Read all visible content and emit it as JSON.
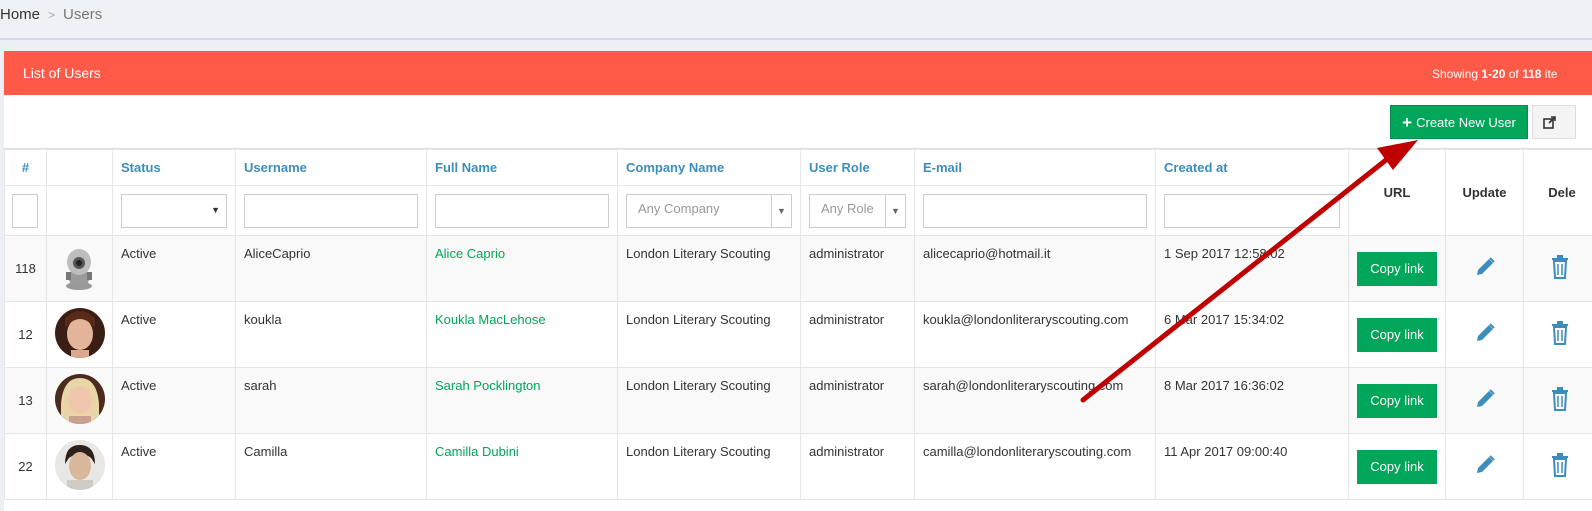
{
  "breadcrumb": {
    "home": "Home",
    "separator": ">",
    "current": "Users"
  },
  "panel": {
    "title": "List of Users",
    "summary_prefix": "Showing ",
    "summary_range": "1-20",
    "summary_of": " of ",
    "summary_total": "118",
    "summary_suffix": " ite"
  },
  "toolbar": {
    "create_label": "Create New User",
    "create_icon": "plus-icon",
    "export_icon": "export-icon"
  },
  "columns": {
    "num": "#",
    "status": "Status",
    "username": "Username",
    "fullname": "Full Name",
    "company": "Company Name",
    "role": "User Role",
    "email": "E-mail",
    "created": "Created at",
    "url": "URL",
    "update": "Update",
    "delete": "Dele"
  },
  "filters": {
    "company_placeholder": "Any Company",
    "role_placeholder": "Any Role"
  },
  "rows": [
    {
      "id": "118",
      "status": "Active",
      "username": "AliceCaprio",
      "fullname": "Alice Caprio",
      "company": "London Literary Scouting",
      "role": "administrator",
      "email": "alicecaprio@hotmail.it",
      "created": "1 Sep 2017 12:58:02",
      "copy": "Copy link"
    },
    {
      "id": "12",
      "status": "Active",
      "username": "koukla",
      "fullname": "Koukla MacLehose",
      "company": "London Literary Scouting",
      "role": "administrator",
      "email": "koukla@londonliteraryscouting.com",
      "created": "6 Mar 2017 15:34:02",
      "copy": "Copy link"
    },
    {
      "id": "13",
      "status": "Active",
      "username": "sarah",
      "fullname": "Sarah Pocklington",
      "company": "London Literary Scouting",
      "role": "administrator",
      "email": "sarah@londonliteraryscouting.com",
      "created": "8 Mar 2017 16:36:02",
      "copy": "Copy link"
    },
    {
      "id": "22",
      "status": "Active",
      "username": "Camilla",
      "fullname": "Camilla Dubini",
      "company": "London Literary Scouting",
      "role": "administrator",
      "email": "camilla@londonliteraryscouting.com",
      "created": "11 Apr 2017 09:00:40",
      "copy": "Copy link"
    }
  ],
  "colors": {
    "header": "#ff5a47",
    "success": "#00a65a",
    "link": "#3c8dbc",
    "annotation_arrow": "#c00000"
  }
}
